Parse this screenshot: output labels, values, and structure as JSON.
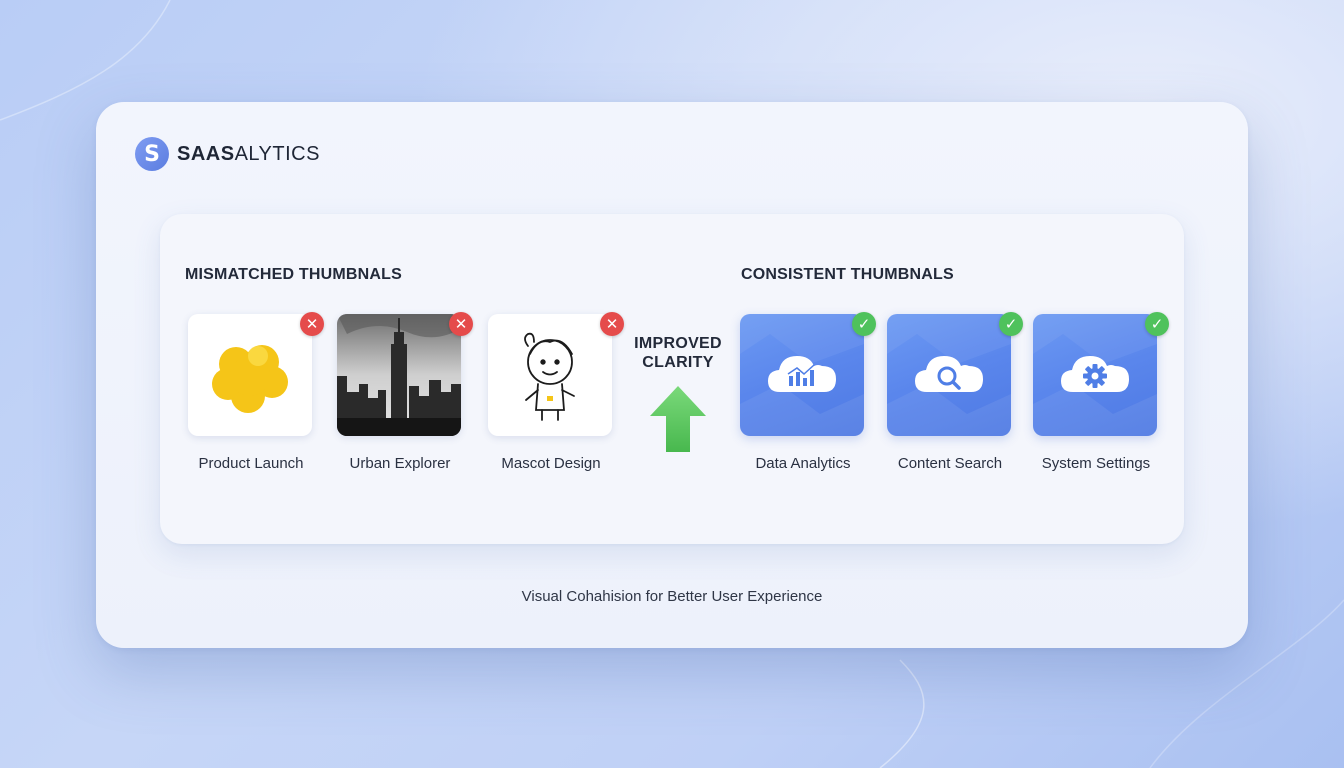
{
  "brand": {
    "logo_letter": "S",
    "name_bold": "SAAS",
    "name_light": "ALYTICS"
  },
  "left_section": {
    "title": "MISMATCHED THUMBNALS",
    "items": [
      {
        "label": "Product Launch",
        "icon": "yellow-blob-icon",
        "status": "x-badge-icon"
      },
      {
        "label": "Urban Explorer",
        "icon": "city-skyline-photo",
        "status": "x-badge-icon"
      },
      {
        "label": "Mascot Design",
        "icon": "mascot-doodle-icon",
        "status": "x-badge-icon"
      }
    ]
  },
  "center": {
    "line1": "IMPROVED",
    "line2": "CLARITY",
    "icon": "up-arrow-icon",
    "arrow_color": "#5bcc5f"
  },
  "right_section": {
    "title": "CONSISTENT THUMBNALS",
    "items": [
      {
        "label": "Data Analytics",
        "icon": "cloud-chart-icon",
        "status": "check-badge-icon"
      },
      {
        "label": "Content Search",
        "icon": "cloud-search-icon",
        "status": "check-badge-icon"
      },
      {
        "label": "System Settings",
        "icon": "cloud-gear-icon",
        "status": "check-badge-icon"
      }
    ]
  },
  "caption": "Visual Cohahision for Better User Experience",
  "colors": {
    "accent_blue": "#5a86ec",
    "error_red": "#e54b4b",
    "success_green": "#4fc25c"
  }
}
